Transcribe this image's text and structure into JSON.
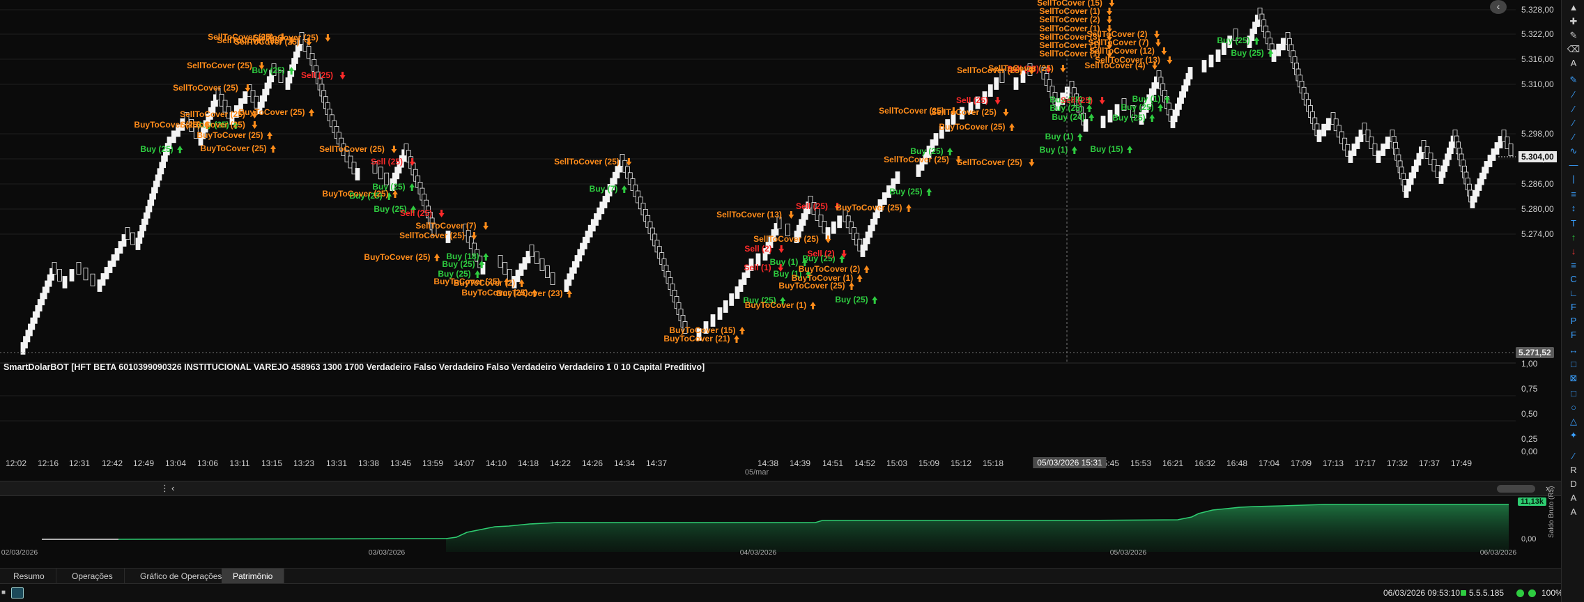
{
  "indicator": {
    "title": "SmartDolarBOT [HFT BETA 6010399090326 INSTITUCIONAL VAREJO 458963 1300 1700 Verdadeiro Falso Verdadeiro Falso Verdadeiro Verdadeiro 1 0 10 Capital Preditivo]"
  },
  "price_axis": {
    "labels": [
      "5.328,00",
      "5.322,00",
      "5.316,00",
      "5.310,00",
      "5.298,00",
      "5.292,00",
      "5.286,00",
      "5.280,00",
      "5.274,00"
    ],
    "current_price": "5.304,00",
    "last_price": "5.271,52"
  },
  "indicator_axis": {
    "labels": [
      "1,00",
      "0,75",
      "0,50",
      "0,25",
      "0,00"
    ]
  },
  "time_axis": {
    "labels": [
      "12:02",
      "12:16",
      "12:31",
      "12:42",
      "12:49",
      "13:04",
      "13:06",
      "13:11",
      "13:15",
      "13:23",
      "13:31",
      "13:38",
      "13:45",
      "13:59",
      "14:07",
      "14:10",
      "14:18",
      "14:22",
      "14:26",
      "14:34",
      "14:37",
      "14:38",
      "14:39",
      "14:51",
      "14:52",
      "15:03",
      "15:09",
      "15:12",
      "15:18",
      "15:45",
      "15:53",
      "16:21",
      "16:32",
      "16:48",
      "17:04",
      "17:09",
      "17:13",
      "17:17",
      "17:32",
      "17:37",
      "17:49"
    ],
    "cursor_label": "05/03/2026 15:31",
    "date": "05/mar"
  },
  "equity": {
    "badge": "11,13k",
    "zero": "0,00",
    "axis_title": "Saldo Bruto (R$)",
    "dates": [
      "02/03/2026",
      "03/03/2026",
      "04/03/2026",
      "05/03/2026",
      "06/03/2026"
    ]
  },
  "tabs": [
    {
      "label": "Resumo"
    },
    {
      "label": "Operações"
    },
    {
      "label": "Gráfico de Operações"
    },
    {
      "label": "Patrimônio",
      "active": true
    }
  ],
  "status": {
    "datetime": "06/03/2026 09:53:10",
    "version": "5.5.5.185",
    "zoom": "100%"
  },
  "signals": {
    "buy": [
      "Buy (25)",
      "Buy (25)",
      "Buy (25)",
      "Buy (25)",
      "Buy (25)",
      "Buy (25)",
      "Buy (25)",
      "Buy (25)",
      "Buy (18)",
      "Buy (7)",
      "Buy (25)",
      "Buy (1)",
      "Buy (1)",
      "Buy (25)",
      "Buy (25)",
      "Buy (25)",
      "Buy (25)",
      "Buy (25)",
      "Buy (24)",
      "Buy (1)",
      "Buy (1)",
      "Buy (15)",
      "Buy (25)",
      "Buy (25)",
      "Buy (1)",
      "Buy (25)",
      "Buy (25)",
      "Buy (25)"
    ],
    "sell": [
      "Sell (25)",
      "Sell (25)",
      "Sell (25)",
      "Sell (2)",
      "Sell (25)",
      "Sell (2)",
      "Sell (1)",
      "Sell (25)",
      "Sell (25)",
      "Sell (25)"
    ],
    "sell_to_cover": [
      "SellToCover (25)",
      "SellToCover (25)",
      "SellToCover (25)",
      "SellToCover (25)",
      "SellToCover (25)",
      "SellToCover (25)",
      "SellToCover (25)",
      "SellToCover (25)",
      "SellToCover (7)",
      "SellToCover (25)",
      "SellToCover (25)",
      "SellToCover (25)",
      "SellToCover (13)",
      "SellToCover (25)",
      "SellToCover (25)",
      "SellToCover (25)",
      "SellToCover (25)",
      "SellToCover (15)",
      "SellToCover (1)",
      "SellToCover (2)",
      "SellToCover (1)",
      "SellToCover (3)",
      "SellToCover (1)",
      "SellToCover (1)",
      "SellToCover (2)",
      "SellToCover (7)",
      "SellToCover (12)",
      "SellToCover (13)",
      "SellToCover (4)",
      "SellToCover (25)",
      "SellToCover (25)",
      "SellToCover (25)"
    ],
    "buy_to_cover": [
      "BuyToCover (25)",
      "BuyToCover (25)",
      "BuyToCover (25)",
      "BuyToCover (25)",
      "BuyToCover (25)",
      "BuyToCover (25)",
      "BuyToCover (25)",
      "BuyToCover (25)",
      "BuyToCover (2)",
      "BuyToCover (23)",
      "BuyToCover (15)",
      "BuyToCover (21)",
      "BuyToCover (1)",
      "BuyToCover (2)",
      "BuyToCover (1)",
      "BuyToCover (25)",
      "BuyToCover (25)",
      "BuyToCover (25)"
    ]
  },
  "colors": {
    "background": "#0b0b0b",
    "buy": "#2ecc40",
    "sell": "#ff2a2a",
    "sell_to_cover": "#ff8c1a",
    "buy_to_cover": "#ff8c1a",
    "equity_line": "#2ecc71"
  }
}
